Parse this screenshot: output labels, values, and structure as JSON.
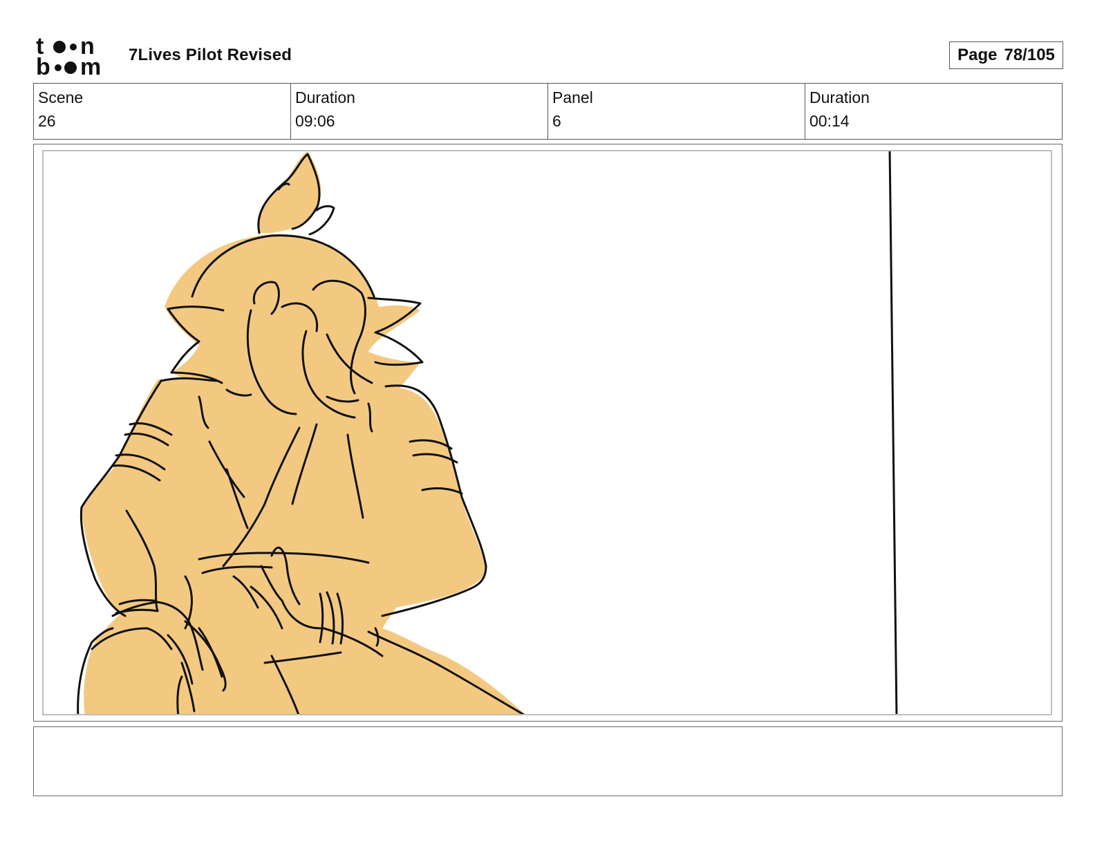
{
  "header": {
    "logo_text": "toon boom",
    "project_title": "7Lives Pilot Revised",
    "page_label": "Page",
    "page_number": "78/105"
  },
  "info": {
    "scene_label": "Scene",
    "scene_value": "26",
    "scene_duration_label": "Duration",
    "scene_duration_value": "09:06",
    "panel_label": "Panel",
    "panel_value": "6",
    "panel_duration_label": "Duration",
    "panel_duration_value": "00:14"
  },
  "panel": {
    "fill_color": "#F3C982",
    "line_color": "#111111"
  },
  "notes": {
    "text": ""
  }
}
